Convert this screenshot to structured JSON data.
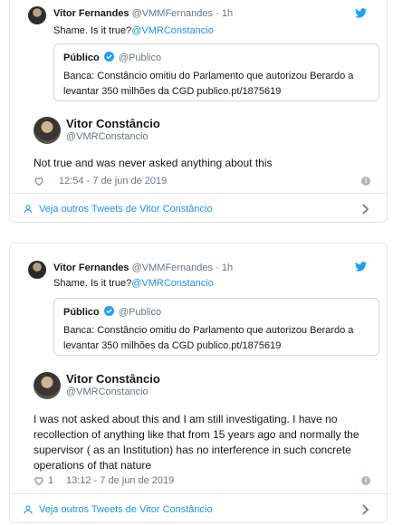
{
  "tweets": [
    {
      "reply": {
        "name": "Vitor Fernandes",
        "handle": "@VMMFernandes",
        "sep": "·",
        "age": "1h",
        "text_prefix": "Shame. Is it true?",
        "mention": "@VMRConstancio"
      },
      "quote": {
        "name": "Público",
        "handle": "@Publico",
        "text": "Banca: Constâncio omitiu do Parlamento que autorizou Berardo a levantar 350 milhões da CGD publico.pt/1875619"
      },
      "author": {
        "name": "Vitor Constâncio",
        "handle": "@VMRConstancio"
      },
      "text": "Not true and was never asked anything about this",
      "likes": "",
      "timestamp": "12:54 - 7 de jun de 2019",
      "more_label": "Veja outros Tweets de Vitor Constâncio"
    },
    {
      "reply": {
        "name": "Vitor Fernandes",
        "handle": "@VMMFernandes",
        "sep": "·",
        "age": "1h",
        "text_prefix": "Shame. Is it true?",
        "mention": "@VMRConstancio"
      },
      "quote": {
        "name": "Público",
        "handle": "@Publico",
        "text": "Banca: Constâncio omitiu do Parlamento que autorizou Berardo a levantar 350 milhões da CGD publico.pt/1875619"
      },
      "author": {
        "name": "Vitor Constâncio",
        "handle": "@VMRConstancio"
      },
      "text": "I was not asked about this and I am still investigating. I have no recollection of anything like that from 15 years ago and normally the supervisor ( as an Institution) has no  interference in such concrete operations of that nature",
      "likes": "1",
      "timestamp": "13:12 - 7 de jun de 2019",
      "more_label": "Veja outros Tweets de Vitor Constâncio"
    }
  ],
  "colors": {
    "link": "#1b95e0",
    "muted": "#657786",
    "border": "#e1e8ed"
  }
}
